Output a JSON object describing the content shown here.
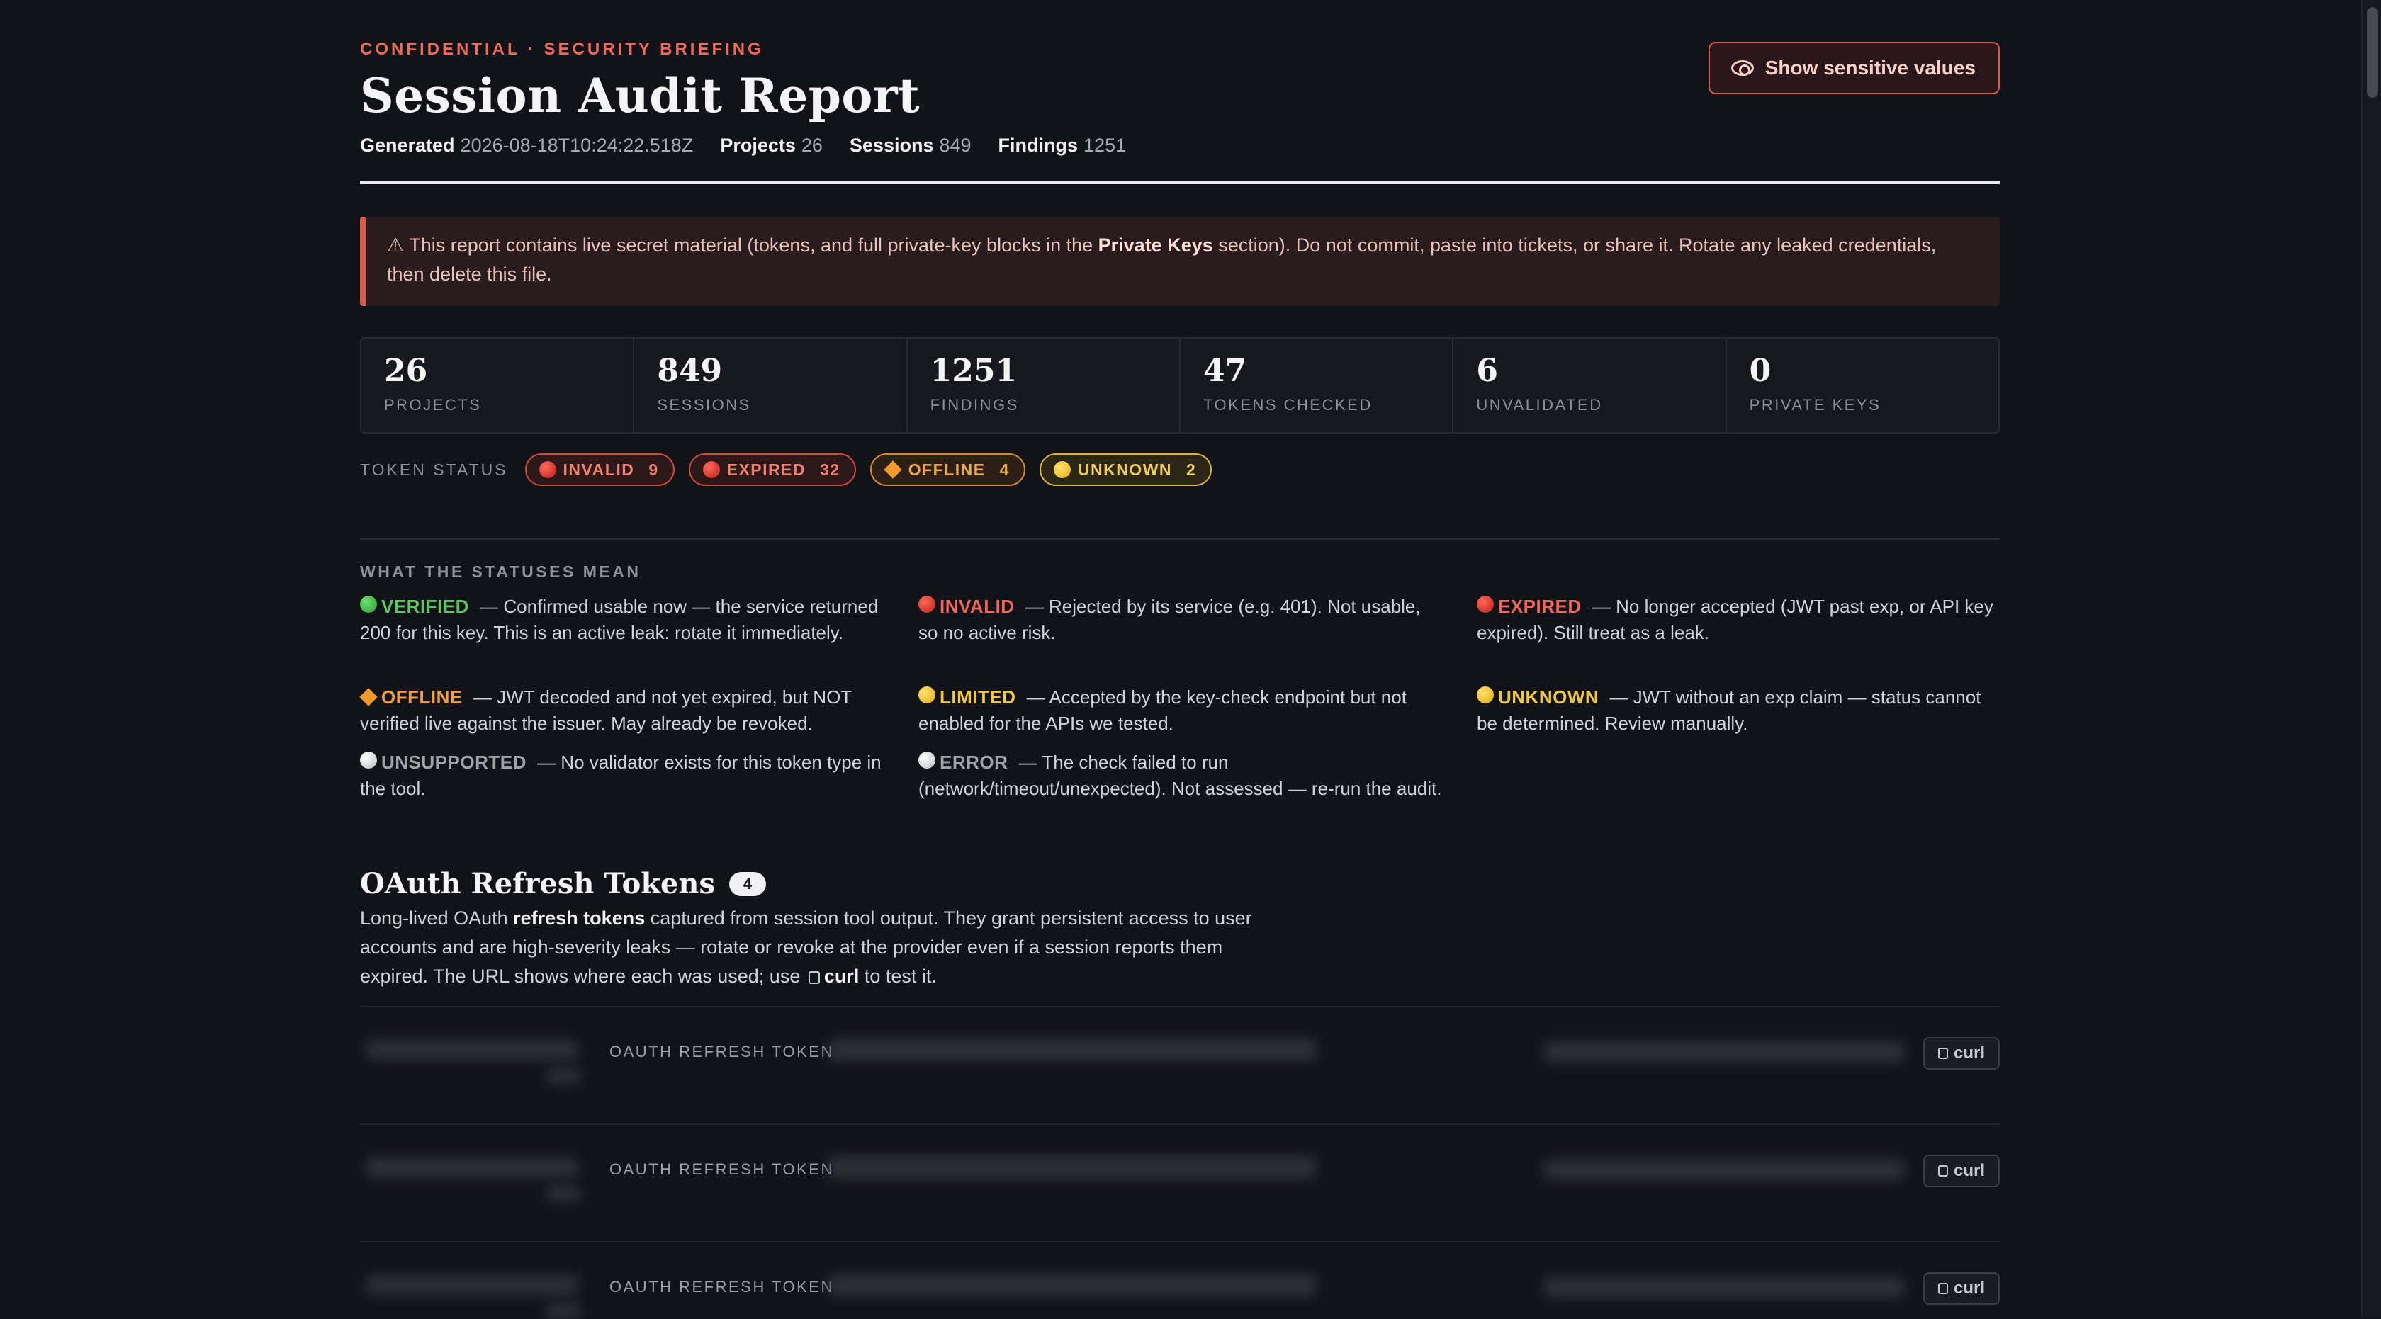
{
  "header": {
    "eyebrow": "CONFIDENTIAL · SECURITY BRIEFING",
    "title": "Session Audit Report",
    "meta": [
      {
        "label": "Generated",
        "value": "2026-08-18T10:24:22.518Z"
      },
      {
        "label": "Projects",
        "value": "26"
      },
      {
        "label": "Sessions",
        "value": "849"
      },
      {
        "label": "Findings",
        "value": "1251"
      }
    ],
    "show_button_label": "Show sensitive values"
  },
  "warning": {
    "prefix": "⚠ This report contains live secret material (tokens, and full private-key blocks in the ",
    "strong": "Private Keys",
    "suffix": " section). Do not commit, paste into tickets, or share it. Rotate any leaked credentials, then delete this file."
  },
  "stats": [
    {
      "value": "26",
      "label": "PROJECTS"
    },
    {
      "value": "849",
      "label": "SESSIONS"
    },
    {
      "value": "1251",
      "label": "FINDINGS"
    },
    {
      "value": "47",
      "label": "TOKENS CHECKED"
    },
    {
      "value": "6",
      "label": "UNVALIDATED"
    },
    {
      "value": "0",
      "label": "PRIVATE KEYS"
    }
  ],
  "token_status": {
    "label": "TOKEN STATUS",
    "pills": [
      {
        "label": "INVALID",
        "count": "9",
        "color": "red"
      },
      {
        "label": "EXPIRED",
        "count": "32",
        "color": "red"
      },
      {
        "label": "OFFLINE",
        "count": "4",
        "color": "orange"
      },
      {
        "label": "UNKNOWN",
        "count": "2",
        "color": "yellow"
      }
    ]
  },
  "legend": {
    "title": "WHAT THE STATUSES MEAN",
    "items": [
      {
        "term": "VERIFIED",
        "desc": " — Confirmed usable now — the service returned 200 for this key. This is an active leak: rotate it immediately."
      },
      {
        "term": "INVALID",
        "desc": " — Rejected by its service (e.g. 401). Not usable, so no active risk."
      },
      {
        "term": "EXPIRED",
        "desc": " — No longer accepted (JWT past exp, or API key expired). Still treat as a leak."
      },
      {
        "term": "OFFLINE",
        "desc": " — JWT decoded and not yet expired, but NOT verified live against the issuer. May already be revoked."
      },
      {
        "term": "LIMITED",
        "desc": " — Accepted by the key-check endpoint but not enabled for the APIs we tested."
      },
      {
        "term": "UNKNOWN",
        "desc": " — JWT without an exp claim — status cannot be determined. Review manually."
      },
      {
        "term": "UNSUPPORTED",
        "desc": " — No validator exists for this token type in the tool."
      },
      {
        "term": "ERROR",
        "desc": " — The check failed to run (network/timeout/unexpected). Not assessed — re-run the audit."
      }
    ]
  },
  "oauth": {
    "title": "OAuth Refresh Tokens",
    "count": "4",
    "desc_1": "Long-lived OAuth ",
    "desc_strong": "refresh tokens",
    "desc_2": " captured from session tool output. They grant persistent access to user accounts and are high-severity leaks — rotate or revoke at the provider even if a session reports them expired. The URL shows where each was used; use ",
    "desc_curl": "curl",
    "desc_3": " to test it.",
    "rows": [
      {
        "kind": "OAUTH REFRESH TOKEN",
        "button": "curl"
      },
      {
        "kind": "OAUTH REFRESH TOKEN",
        "button": "curl"
      },
      {
        "kind": "OAUTH REFRESH TOKEN",
        "button": "curl"
      }
    ]
  }
}
